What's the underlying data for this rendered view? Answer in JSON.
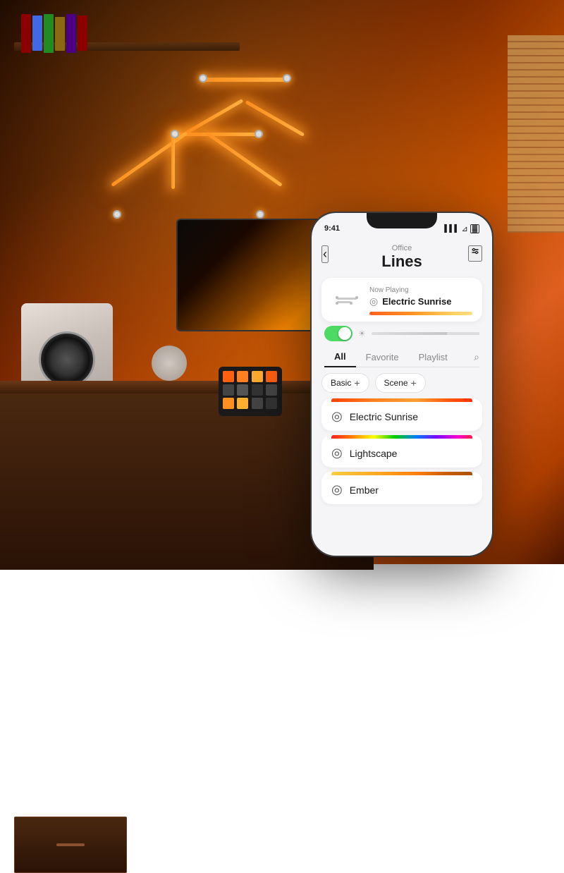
{
  "background": {
    "colors": [
      "#1a0800",
      "#7a2800",
      "#e06020"
    ]
  },
  "phone": {
    "status_bar": {
      "time": "9:41",
      "signal": "▌▌▌",
      "wifi": "wifi",
      "battery": "battery"
    },
    "header": {
      "back_label": "‹",
      "subtitle": "Office",
      "title": "Lines",
      "settings_icon": "⚌"
    },
    "now_playing": {
      "label": "Now Playing",
      "name": "Electric Sunrise",
      "drop_icon": "○"
    },
    "tabs": {
      "items": [
        {
          "label": "All",
          "active": true
        },
        {
          "label": "Favorite",
          "active": false
        },
        {
          "label": "Playlist",
          "active": false
        }
      ],
      "search_icon": "⌕"
    },
    "pills": [
      {
        "label": "Basic",
        "plus": "+"
      },
      {
        "label": "Scene",
        "plus": "+"
      }
    ],
    "scenes": [
      {
        "name": "Electric Sunrise",
        "bar_class": "scene-bar-electric"
      },
      {
        "name": "Lightscape",
        "bar_class": "scene-bar-lightscape"
      },
      {
        "name": "Ember",
        "bar_class": "scene-bar-ember"
      }
    ]
  }
}
